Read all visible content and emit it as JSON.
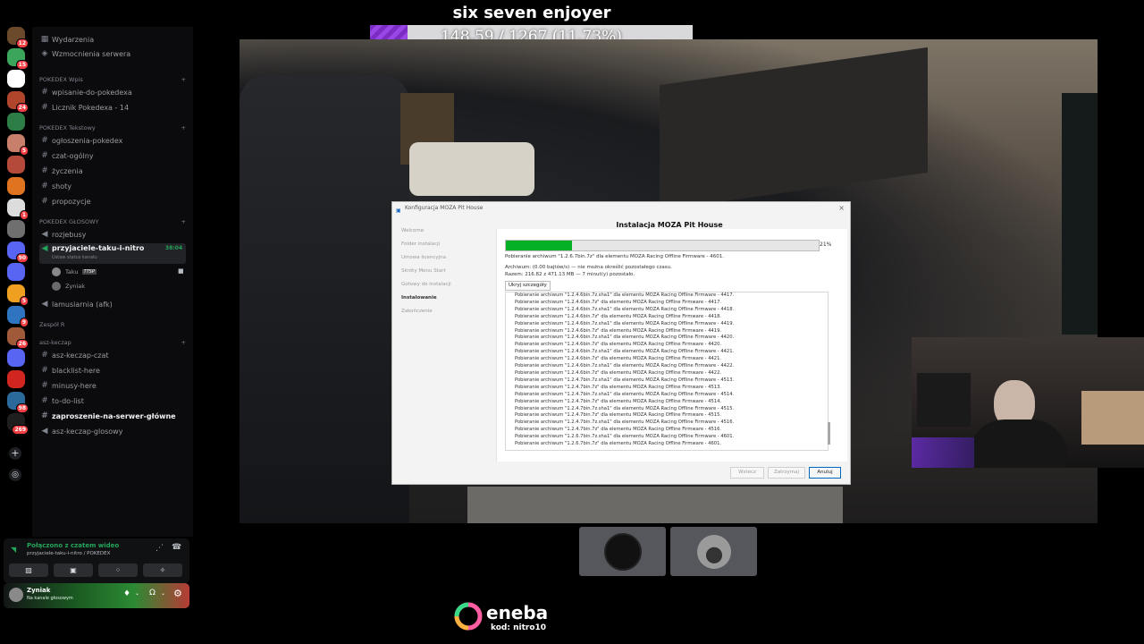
{
  "overlay": {
    "streamer_name": "six seven enjoyer",
    "progress_text": "148.59 / 1267 (11.73%)",
    "progress_fraction": 0.1173,
    "sponsor_name": "eneba",
    "sponsor_code": "kod: nitro10"
  },
  "server_rail": [
    {
      "name": "server-1",
      "color": "#6b4a2c",
      "badge": "12"
    },
    {
      "name": "server-2",
      "color": "#3ba55c",
      "badge": "15"
    },
    {
      "name": "server-3",
      "color": "#ffffff",
      "badge": ""
    },
    {
      "name": "server-4",
      "color": "#b0452b",
      "badge": "24"
    },
    {
      "name": "server-5",
      "color": "#2d7d46",
      "badge": ""
    },
    {
      "name": "server-6",
      "color": "#c9806a",
      "badge": "5"
    },
    {
      "name": "server-7",
      "color": "#b34a3a",
      "badge": ""
    },
    {
      "name": "server-8",
      "color": "#e0731f",
      "badge": ""
    },
    {
      "name": "server-9",
      "color": "#dcdcdc",
      "badge": "1"
    },
    {
      "name": "server-10",
      "color": "#6f6f6f",
      "badge": ""
    },
    {
      "name": "server-11",
      "color": "#5865f2",
      "badge": "90"
    },
    {
      "name": "server-12",
      "color": "#5865f2",
      "badge": ""
    },
    {
      "name": "server-13",
      "color": "#f0a020",
      "badge": "5"
    },
    {
      "name": "server-14",
      "color": "#2f74c0",
      "badge": "9"
    },
    {
      "name": "server-15",
      "color": "#a05a3a",
      "badge": "26"
    },
    {
      "name": "server-16",
      "color": "#5865f2",
      "badge": ""
    },
    {
      "name": "server-17",
      "color": "#d1261f",
      "badge": ""
    },
    {
      "name": "server-18",
      "color": "#2a6a9a",
      "badge": "98"
    },
    {
      "name": "server-19",
      "color": "#1e1e1e",
      "badge": "269"
    }
  ],
  "sidebar": {
    "top_items": [
      "Wydarzenia",
      "Wzmocnienia serwera"
    ],
    "categories": [
      {
        "label": "POKEDEX Wpis",
        "channels": [
          "wpisanie-do-pokedexa",
          "Licznik Pokedexa - 14"
        ]
      },
      {
        "label": "POKEDEX Tekstowy",
        "channels": [
          "ogłoszenia-pokedex",
          "czat-ogólny",
          "życzenia",
          "shoty",
          "propozycje"
        ]
      },
      {
        "label": "POKEDEX GŁOSOWY",
        "channels": [
          "rozjebusy",
          "przyjaciele-taku-i-nitro"
        ]
      },
      {
        "label": "Zespół R",
        "channels": []
      },
      {
        "label": "asz-keczap",
        "channels": [
          "asz-keczap-czat",
          "blacklist-here",
          "minusy-here",
          "to-do-list",
          "zaproszenie-na-serwer-główne",
          "asz-keczap-glosowy"
        ]
      }
    ],
    "active_voice": {
      "status_hint": "Ustaw status kanału",
      "timer": "38:04",
      "users": [
        "Taku",
        "Zyniak"
      ],
      "taku_tag": "TTSP"
    },
    "afk_channel": "lamusiarnia (afk)"
  },
  "voice_panel": {
    "status": "Połączono z czatem wideo",
    "location": "przyjaciele-taku-i-nitro / POKEDEX"
  },
  "user_panel": {
    "name": "Zyniak",
    "status": "Na kanale głosowym"
  },
  "installer": {
    "window_title": "Konfiguracja MOZA Pit House",
    "heading": "Instalacja MOZA Pit House",
    "steps": [
      "Welcome",
      "Folder instalacji",
      "Umowa licencyjna",
      "Skróty Menu Start",
      "Gotowy do instalacji",
      "Instalowanie",
      "Zakończenie"
    ],
    "current_step": "Instalowanie",
    "progress_fraction": 0.21,
    "progress_label": "21%",
    "status_line": "Pobieranie archiwum \"1.2.6.7bin.7z\" dla elementu MOZA Racing Offline Firmware - 4601.",
    "archive_line": "Archiwum: (0.00 bajtów/s) — nie można określić pozostałego czasu.",
    "total_line": "Razem: 216.82 z 471.13 MB — 7 minut(y) pozostało.",
    "details_button": "Ukryj szczegóły",
    "log_lines": [
      "Pobieranie archiwum \"1.2.4.6bin.7z.sha1\" dla elementu MOZA Racing Offline Firmware - 4417.",
      "Pobieranie archiwum \"1.2.4.6bin.7z\" dla elementu MOZA Racing Offline Firmware - 4417.",
      "Pobieranie archiwum \"1.2.4.6bin.7z.sha1\" dla elementu MOZA Racing Offline Firmware - 4418.",
      "Pobieranie archiwum \"1.2.4.6bin.7z\" dla elementu MOZA Racing Offline Firmware - 4418.",
      "Pobieranie archiwum \"1.2.4.6bin.7z.sha1\" dla elementu MOZA Racing Offline Firmware - 4419.",
      "Pobieranie archiwum \"1.2.4.6bin.7z\" dla elementu MOZA Racing Offline Firmware - 4419.",
      "Pobieranie archiwum \"1.2.4.6bin.7z.sha1\" dla elementu MOZA Racing Offline Firmware - 4420.",
      "Pobieranie archiwum \"1.2.4.6bin.7z\" dla elementu MOZA Racing Offline Firmware - 4420.",
      "Pobieranie archiwum \"1.2.4.6bin.7z.sha1\" dla elementu MOZA Racing Offline Firmware - 4421.",
      "Pobieranie archiwum \"1.2.4.6bin.7z\" dla elementu MOZA Racing Offline Firmware - 4421.",
      "Pobieranie archiwum \"1.2.4.6bin.7z.sha1\" dla elementu MOZA Racing Offline Firmware - 4422.",
      "Pobieranie archiwum \"1.2.4.6bin.7z\" dla elementu MOZA Racing Offline Firmware - 4422.",
      "Pobieranie archiwum \"1.2.4.7bin.7z.sha1\" dla elementu MOZA Racing Offline Firmware - 4513.",
      "Pobieranie archiwum \"1.2.4.7bin.7z\" dla elementu MOZA Racing Offline Firmware - 4513.",
      "Pobieranie archiwum \"1.2.4.7bin.7z.sha1\" dla elementu MOZA Racing Offline Firmware - 4514.",
      "Pobieranie archiwum \"1.2.4.7bin.7z\" dla elementu MOZA Racing Offline Firmware - 4514.",
      "Pobieranie archiwum \"1.2.4.7bin.7z.sha1\" dla elementu MOZA Racing Offline Firmware - 4515.",
      "Pobieranie archiwum \"1.2.4.7bin.7z\" dla elementu MOZA Racing Offline Firmware - 4515.",
      "Pobieranie archiwum \"1.2.4.7bin.7z.sha1\" dla elementu MOZA Racing Offline Firmware - 4516.",
      "Pobieranie archiwum \"1.2.4.7bin.7z\" dla elementu MOZA Racing Offline Firmware - 4516.",
      "Pobieranie archiwum \"1.2.6.7bin.7z.sha1\" dla elementu MOZA Racing Offline Firmware - 4601.",
      "Pobieranie archiwum \"1.2.6.7bin.7z\" dla elementu MOZA Racing Offline Firmware - 4601."
    ],
    "buttons": {
      "back": "Wstecz",
      "pause": "Zatrzymaj",
      "cancel": "Anuluj"
    }
  },
  "colors": {
    "discord_green": "#23a55a",
    "progress_green": "#06b025",
    "overlay_purple": "#8e3ad8"
  }
}
